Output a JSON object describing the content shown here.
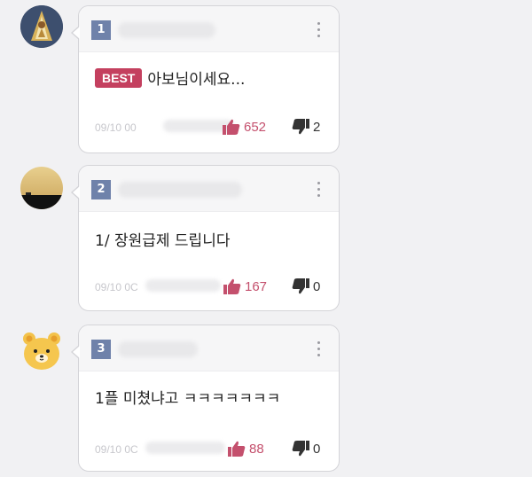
{
  "comments": [
    {
      "number": "1",
      "best_label": "BEST",
      "text": "아보님이세요...",
      "date": "09/10 00",
      "likes": "652",
      "dislikes": "2",
      "avatar": "robed-figure-avatar"
    },
    {
      "number": "2",
      "text": "1/ 장원급제 드립니다",
      "date": "09/10 0C",
      "likes": "167",
      "dislikes": "0",
      "avatar": "sunset-field-avatar"
    },
    {
      "number": "3",
      "text": "1플 미쳤냐고 ㅋㅋㅋㅋㅋㅋㅋ",
      "date": "09/10 0C",
      "likes": "88",
      "dislikes": "0",
      "avatar": "bear-face-avatar"
    }
  ],
  "colors": {
    "best_badge": "#c4405f",
    "like": "#c4506d",
    "number_badge": "#6f82aa"
  },
  "icons": [
    "thumbs-up-icon",
    "thumbs-down-icon",
    "more-vertical-icon"
  ]
}
